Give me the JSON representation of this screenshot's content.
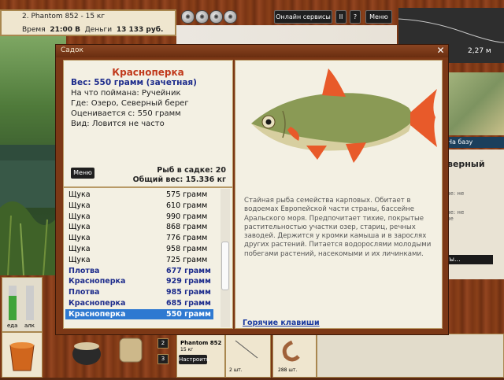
{
  "game_info": {
    "rod": "2. Phantom 852 - 15 кг",
    "time_label": "Время",
    "time_value": "21:00 В",
    "money_label": "Деньги",
    "money_value": "13 133 руб."
  },
  "topbar": {
    "online_label": "Онлайн сервисы",
    "pause_label": "II",
    "help_label": "?",
    "menu_label": "Меню"
  },
  "right_panel": {
    "depth": "2,27 м",
    "to_base_label": "На базу",
    "title_partial": "верный",
    "small_lines": [
      "ые: не",
      "ые: не",
      "ые"
    ],
    "bottom_bar": "ты..."
  },
  "dialog": {
    "title": "Садок",
    "close": "✕",
    "fish_name": "Красноперка",
    "weight_line": "Вес: 550 грамм (зачетная)",
    "caught_on": "На что поймана: Ручейник",
    "where": "Где: Озеро, Северный берег",
    "value": "Оценивается с: 550 грамм",
    "species": "Вид: Ловится не часто",
    "menu_button": "Меню",
    "fish_count": "Рыб в садке: 20",
    "total_weight": "Общий вес: 15.336 кг",
    "description": "Стайная рыба семейства карповых. Обитает в водоемах Европейской части страны, бассейне Аральского моря. Предпочитает тихие, покрытые растительностью участки озер, стариц, речных заводей. Держится у кромки камыша и в зарослях других растений. Питается водорослями молодыми побегами растений, насекомыми и их личинками.",
    "hotkeys": "Горячие клавиши"
  },
  "catch_list": [
    {
      "name": "Щука",
      "weight": "575 грамм",
      "style": "normal"
    },
    {
      "name": "Щука",
      "weight": "610 грамм",
      "style": "normal"
    },
    {
      "name": "Щука",
      "weight": "990 грамм",
      "style": "normal"
    },
    {
      "name": "Щука",
      "weight": "868 грамм",
      "style": "normal"
    },
    {
      "name": "Щука",
      "weight": "776 грамм",
      "style": "normal"
    },
    {
      "name": "Щука",
      "weight": "958 грамм",
      "style": "normal"
    },
    {
      "name": "Щука",
      "weight": "725 грамм",
      "style": "normal"
    },
    {
      "name": "Плотва",
      "weight": "677 грамм",
      "style": "bold"
    },
    {
      "name": "Красноперка",
      "weight": "929 грамм",
      "style": "bold"
    },
    {
      "name": "Плотва",
      "weight": "985 грамм",
      "style": "bold"
    },
    {
      "name": "Красноперка",
      "weight": "685 грамм",
      "style": "bold"
    },
    {
      "name": "Красноперка",
      "weight": "550 грамм",
      "style": "selected"
    }
  ],
  "bottom": {
    "meter1": "еда",
    "meter2": "алк",
    "slot_num1": "2",
    "slot_num2": "3",
    "rod_label": "Phantom 852",
    "rod_sub": "15 кг",
    "setup_button": "Настроить",
    "count1": "2 шт.",
    "count2": "288 шт.",
    "food_level": 0.7
  },
  "colors": {
    "fish_name": "#c0391b",
    "bold_rows": "#1d2c8c",
    "selected": "#2e79d1"
  }
}
